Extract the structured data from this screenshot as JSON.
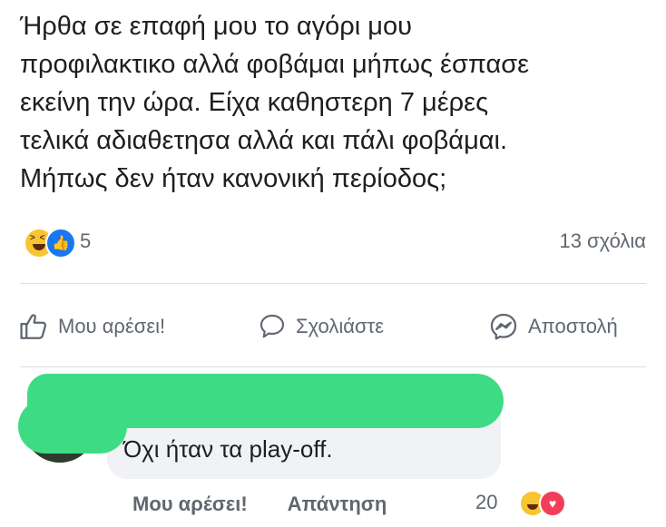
{
  "post": {
    "text": "Ήρθα σε επαφή μου το αγόρι μου\nπροφιλακτικο αλλά φοβάμαι μήπως έσπασε\nεκείνη την ώρα. Είχα καθηστερη 7 μέρες\nτελικά αδιαθετησα αλλά και πάλι φοβάμαι.\nΜήπως δεν ήταν κανονική περίοδος;",
    "reaction_count": "5",
    "comments_count": "13 σχόλια",
    "reaction_icons": [
      "haha-icon",
      "like-icon"
    ]
  },
  "actions": {
    "like_label": "Μου αρέσει!",
    "comment_label": "Σχολιάστε",
    "send_label": "Αποστολή"
  },
  "comment": {
    "text": "Όχι ήταν τα play-off.",
    "like_label": "Μου αρέσει!",
    "reply_label": "Απάντηση",
    "reaction_count": "20",
    "reaction_icons": [
      "haha-icon",
      "love-icon"
    ]
  },
  "colors": {
    "facebook_blue": "#1877f2",
    "redaction_green": "#3ddc84",
    "love_red": "#f33e58"
  }
}
